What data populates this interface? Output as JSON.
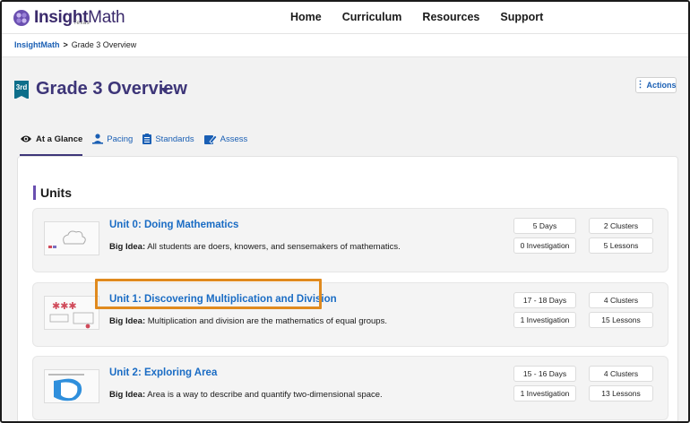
{
  "app": {
    "brand_bold": "Insight",
    "brand_light": "Math",
    "brand_sub": "Texas"
  },
  "nav": {
    "items": [
      "Home",
      "Curriculum",
      "Resources",
      "Support"
    ]
  },
  "breadcrumb": {
    "root": "InsightMath",
    "separator": ">",
    "current": "Grade 3 Overview"
  },
  "header": {
    "grade_badge": "3rd",
    "title": "Grade 3 Overview",
    "actions_label": "Actions"
  },
  "tabs": [
    {
      "label": "At a Glance",
      "icon": "eye-icon",
      "active": true
    },
    {
      "label": "Pacing",
      "icon": "person-pacing-icon",
      "active": false
    },
    {
      "label": "Standards",
      "icon": "clipboard-icon",
      "active": false
    },
    {
      "label": "Assess",
      "icon": "assess-pencil-icon",
      "active": false
    }
  ],
  "units_section": {
    "title": "Units",
    "big_idea_label": "Big Idea:",
    "units": [
      {
        "title": "Unit 0: Doing Mathematics",
        "big_idea": "All students are doers, knowers, and sensemakers of mathematics.",
        "days": "5 Days",
        "clusters": "2 Clusters",
        "investigations": "0 Investigation",
        "lessons": "5 Lessons"
      },
      {
        "title": "Unit 1: Discovering Multiplication and Division",
        "big_idea": "Multiplication and division are the mathematics of equal groups.",
        "days": "17 - 18 Days",
        "clusters": "4 Clusters",
        "investigations": "1 Investigation",
        "lessons": "15 Lessons"
      },
      {
        "title": "Unit 2: Exploring Area",
        "big_idea": "Area is a way to describe and quantify two-dimensional space.",
        "days": "15 - 16 Days",
        "clusters": "4 Clusters",
        "investigations": "1 Investigation",
        "lessons": "13 Lessons"
      }
    ]
  },
  "colors": {
    "brand_purple": "#3d3578",
    "link_blue": "#1a6cc4",
    "highlight_orange": "#e08a1e",
    "grade_badge_teal": "#0d6e8a"
  }
}
